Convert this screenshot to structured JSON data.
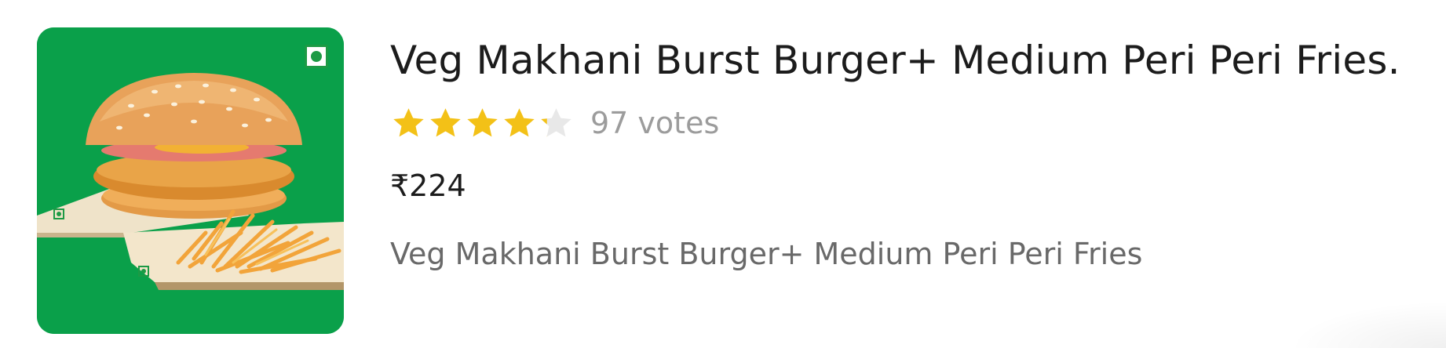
{
  "item": {
    "title": "Veg Makhani Burst Burger+ Medium Peri Peri Fries.",
    "rating": {
      "stars_filled": 4.25,
      "stars_total": 5,
      "votes_label": "97 votes",
      "star_color": "#f3c117",
      "star_empty_color": "#e8e8e8"
    },
    "price": "₹224",
    "description": "Veg Makhani Burst Burger+ Medium Peri Peri Fries",
    "image": {
      "icon": "burger-fries-image",
      "background_color": "#0aa04a"
    },
    "veg_indicator": {
      "icon": "veg-indicator-icon",
      "color": "#1d9a45"
    }
  }
}
